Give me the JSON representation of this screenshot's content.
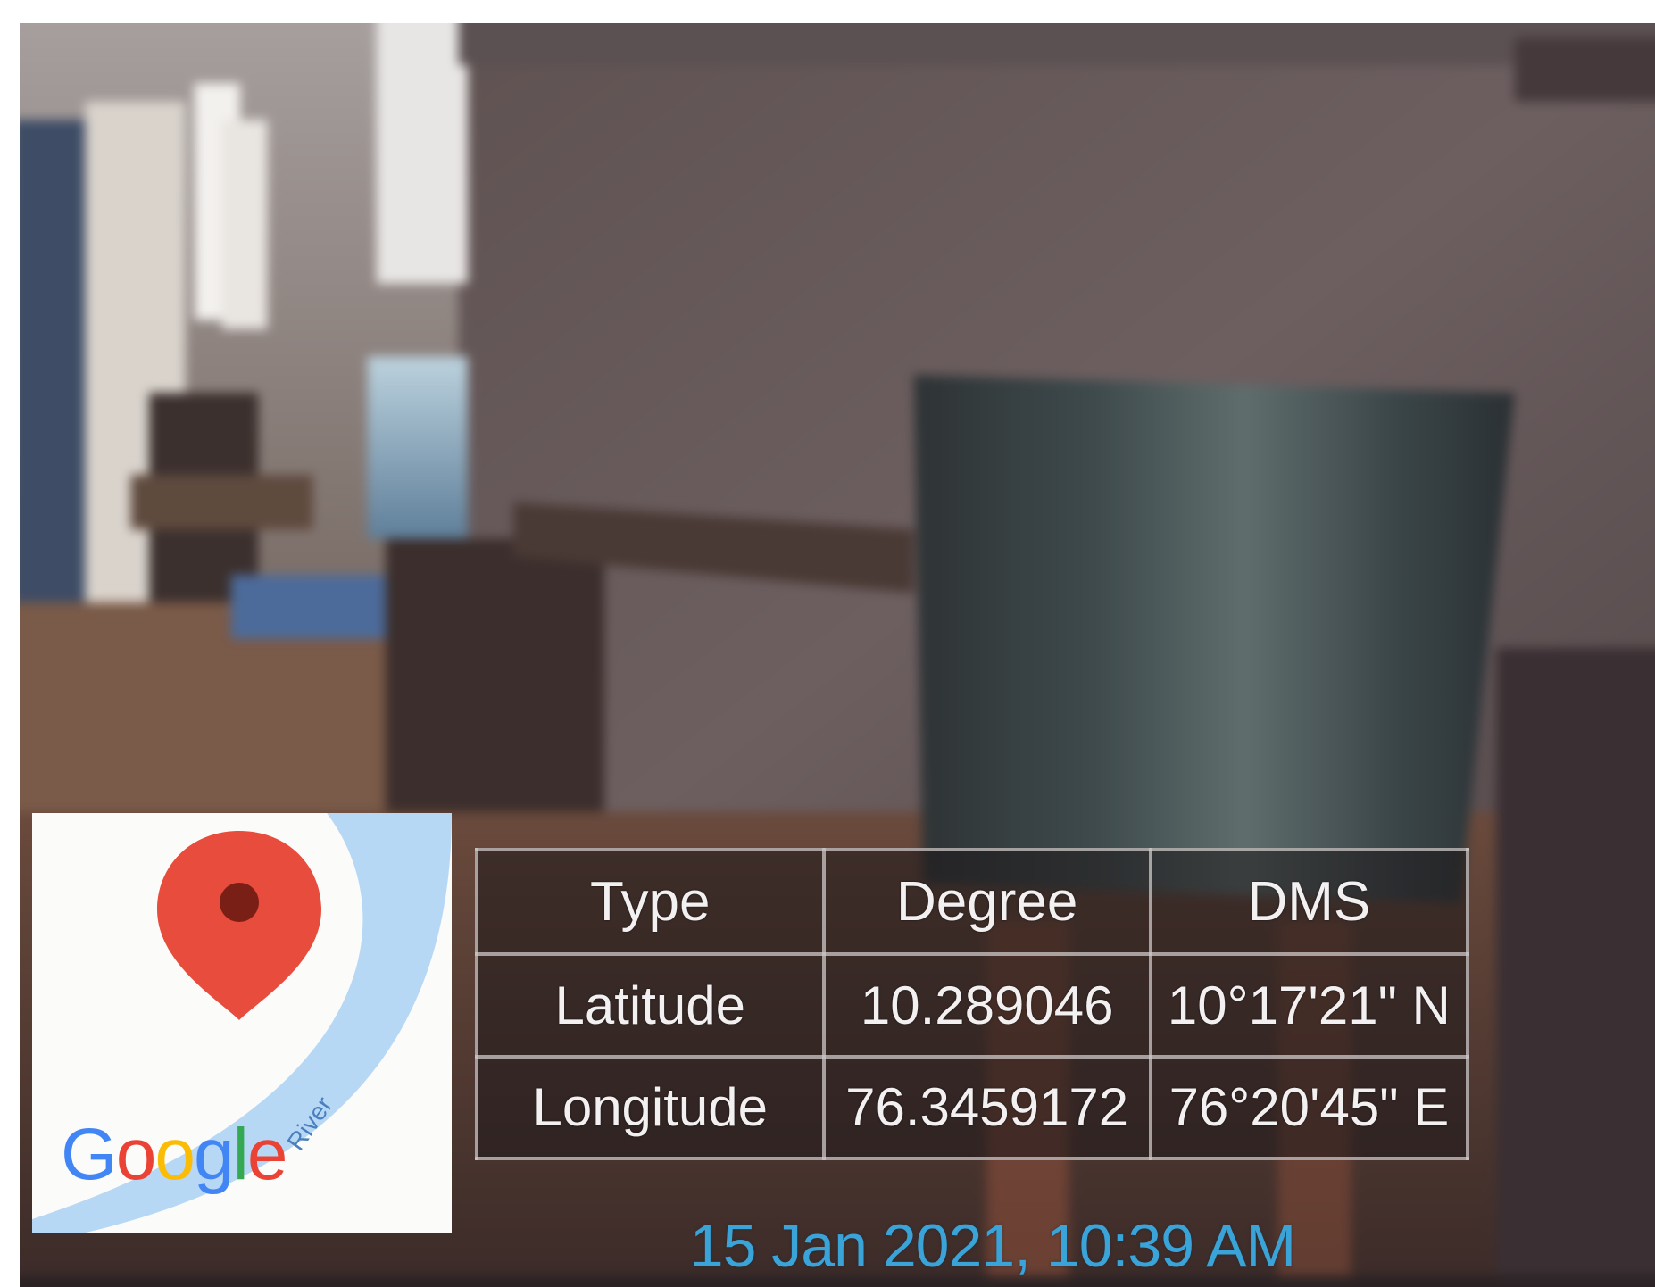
{
  "map": {
    "logo_text": "Google",
    "river_label": "River",
    "pin_color": "#E74C3C",
    "river_color": "#AFD3F5"
  },
  "coordinates": {
    "headers": [
      "Type",
      "Degree",
      "DMS"
    ],
    "rows": [
      [
        "Latitude",
        "10.289046",
        "10°17'21\" N"
      ],
      [
        "Longitude",
        "76.3459172",
        "76°20'45\" E"
      ]
    ]
  },
  "timestamp": "15 Jan 2021, 10:39 AM",
  "colors": {
    "timestamp": "#3aa3d8",
    "table_border": "#cdc8c8",
    "text": "#f2f0f0"
  }
}
